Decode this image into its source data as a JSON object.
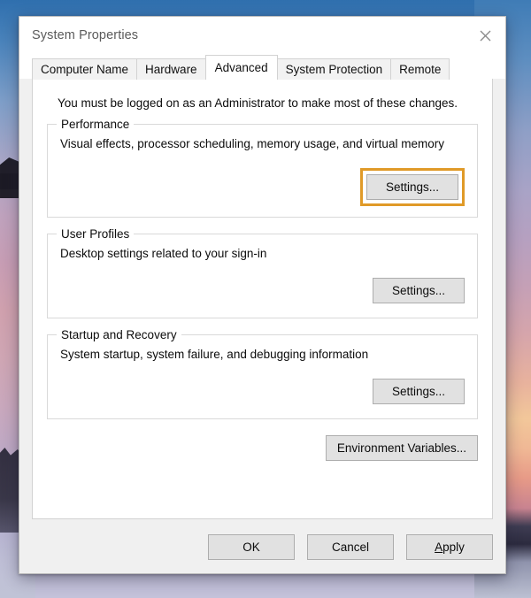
{
  "window": {
    "title": "System Properties",
    "close_icon": "close-icon"
  },
  "tabs": [
    {
      "label": "Computer Name",
      "selected": false
    },
    {
      "label": "Hardware",
      "selected": false
    },
    {
      "label": "Advanced",
      "selected": true
    },
    {
      "label": "System Protection",
      "selected": false
    },
    {
      "label": "Remote",
      "selected": false
    }
  ],
  "main": {
    "admin_note": "You must be logged on as an Administrator to make most of these changes.",
    "groups": [
      {
        "title": "Performance",
        "description": "Visual effects, processor scheduling, memory usage, and virtual memory",
        "button_label": "Settings...",
        "highlighted": true
      },
      {
        "title": "User Profiles",
        "description": "Desktop settings related to your sign-in",
        "button_label": "Settings...",
        "highlighted": false
      },
      {
        "title": "Startup and Recovery",
        "description": "System startup, system failure, and debugging information",
        "button_label": "Settings...",
        "highlighted": false
      }
    ],
    "environment_variables_label": "Environment Variables..."
  },
  "footer": {
    "ok_label": "OK",
    "cancel_label": "Cancel",
    "apply_accel": "A",
    "apply_rest": "pply"
  },
  "colors": {
    "highlight": "#e09a28",
    "dialog_bg": "#f0f0f0",
    "panel_bg": "#ffffff",
    "button_face": "#e1e1e1"
  }
}
